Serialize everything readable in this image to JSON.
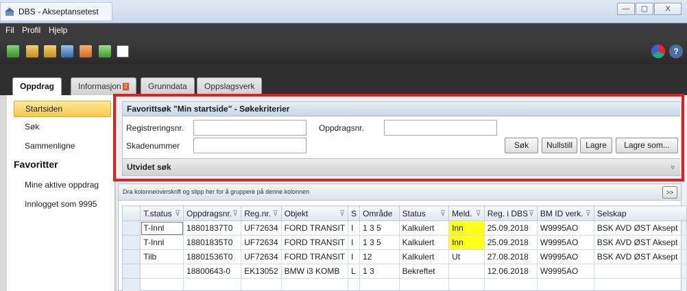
{
  "window": {
    "title": "DBS - Akseptansetest",
    "min": "—",
    "max": "▢",
    "close": "X"
  },
  "menu": {
    "items": [
      "Fil",
      "Profil",
      "Hjelp"
    ]
  },
  "tabs": [
    {
      "label": "Oppdrag"
    },
    {
      "label": "Informasjon",
      "badge": "2"
    },
    {
      "label": "Grunndata"
    },
    {
      "label": "Oppslagsverk"
    }
  ],
  "sidebar": {
    "items": [
      "Startsiden",
      "Søk",
      "Sammenligne"
    ],
    "favorites_heading": "Favoritter",
    "favorites": [
      "Mine aktive oppdrag",
      "Innlogget som 9995"
    ]
  },
  "search": {
    "header": "Favorittsøk \"Min startside\" - Søkekriterier",
    "reg_label": "Registreringsnr.",
    "reg_value": "",
    "oppdrag_label": "Oppdragsnr.",
    "oppdrag_value": "",
    "skade_label": "Skadenummer",
    "skade_value": "",
    "btn_sok": "Søk",
    "btn_nullstill": "Nullstill",
    "btn_lagre": "Lagre",
    "btn_lagre_som": "Lagre som...",
    "advanced_label": "Utvidet søk",
    "advanced_chevron": "»"
  },
  "grid": {
    "group_hint": "Dra kolonneoverskrift og slipp her for å gruppere på denne kolonnen",
    "more_button": ">>",
    "columns": [
      "",
      "T.status",
      "Oppdragsnr.",
      "Reg.nr.",
      "Objekt",
      "S",
      "Område",
      "Status",
      "Meld.",
      "Reg. i DBS",
      "BM ID verk.",
      "Selskap"
    ],
    "filterable": [
      false,
      true,
      true,
      true,
      true,
      false,
      false,
      true,
      true,
      true,
      true,
      false
    ],
    "rows": [
      [
        "",
        "T-Innl",
        "18801837T0",
        "UF72634",
        "FORD TRANSIT",
        "I",
        "1 3 5",
        "Kalkulert",
        "Inn",
        "25.09.2018",
        "W9995AO",
        "BSK AVD ØST Aksept"
      ],
      [
        "",
        "T-Innl",
        "18801835T0",
        "UF72634",
        "FORD TRANSIT",
        "I",
        "1 3 5",
        "Kalkulert",
        "Inn",
        "25.09.2018",
        "W9995AO",
        "BSK AVD ØST Aksept"
      ],
      [
        "",
        "Tilb",
        "18801536T0",
        "UF72634",
        "FORD TRANSIT",
        "I",
        "12",
        "Kalkulert",
        "Ut",
        "27.08.2018",
        "W9995AO",
        "BSK AVD ØST Aksept"
      ],
      [
        "",
        "",
        "18800643-0",
        "EK13052",
        "BMW i3 KOMB",
        "L",
        "1 3",
        "Bekreftet",
        "",
        "12.06.2018",
        "W9995AO",
        ""
      ],
      [
        "",
        "",
        "",
        "",
        "",
        "",
        "",
        "",
        "",
        "",
        "",
        ""
      ]
    ]
  },
  "colors": {
    "highlight_border": "#e21f1f",
    "meld_inn_bg": "#ffff1a",
    "active_nav": "#f7c94c"
  }
}
